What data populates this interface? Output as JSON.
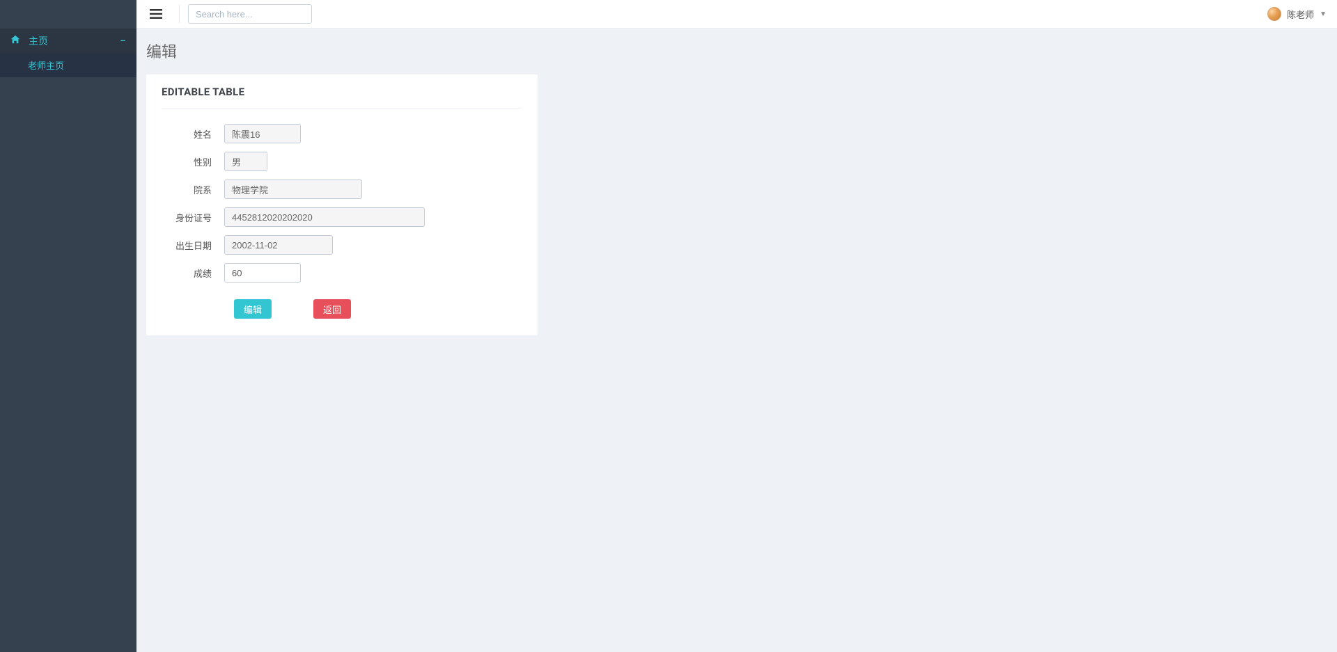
{
  "sidebar": {
    "home_label": "主页",
    "submenu_label": "老师主页"
  },
  "topbar": {
    "search_placeholder": "Search here...",
    "username": "陈老师"
  },
  "page": {
    "title": "编辑"
  },
  "panel": {
    "title": "EDITABLE TABLE"
  },
  "form": {
    "name_label": "姓名",
    "name_value": "陈震16",
    "gender_label": "性别",
    "gender_value": "男",
    "dept_label": "院系",
    "dept_value": "物理学院",
    "idcard_label": "身份证号",
    "idcard_value": "4452812020202020",
    "dob_label": "出生日期",
    "dob_value": "2002-11-02",
    "grade_label": "成绩",
    "grade_value": "60"
  },
  "buttons": {
    "edit": "编辑",
    "back": "返回"
  }
}
